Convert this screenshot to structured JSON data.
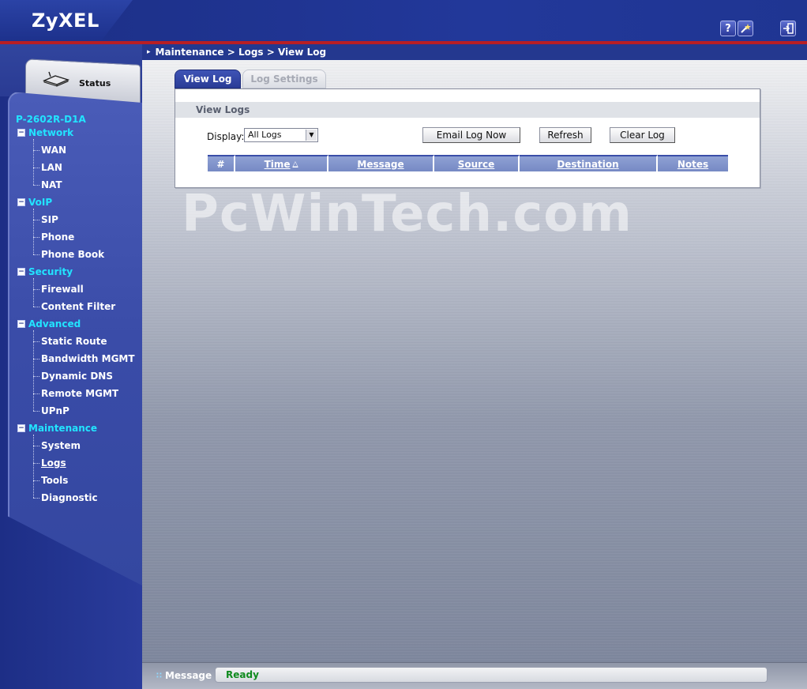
{
  "header": {
    "brand": "ZyXEL",
    "icons": [
      "help-icon",
      "wizard-icon",
      "logout-icon"
    ]
  },
  "sidebar": {
    "status_label": "Status",
    "device": "P-2602R-D1A",
    "sections": [
      {
        "label": "Network",
        "items": [
          "WAN",
          "LAN",
          "NAT"
        ]
      },
      {
        "label": "VoIP",
        "items": [
          "SIP",
          "Phone",
          "Phone Book"
        ]
      },
      {
        "label": "Security",
        "items": [
          "Firewall",
          "Content Filter"
        ]
      },
      {
        "label": "Advanced",
        "items": [
          "Static Route",
          "Bandwidth MGMT",
          "Dynamic DNS",
          "Remote MGMT",
          "UPnP"
        ]
      },
      {
        "label": "Maintenance",
        "items": [
          "System",
          "Logs",
          "Tools",
          "Diagnostic"
        ]
      }
    ],
    "active_item": "Logs"
  },
  "breadcrumb": "Maintenance > Logs > View Log",
  "tabs": [
    {
      "label": "View Log",
      "active": true
    },
    {
      "label": "Log Settings",
      "active": false
    }
  ],
  "panel": {
    "title": "View Logs",
    "display_label": "Display:",
    "display_value": "All Logs",
    "buttons": {
      "email": "Email Log Now",
      "refresh": "Refresh",
      "clear": "Clear Log"
    },
    "columns": [
      "#",
      "Time",
      "Message",
      "Source",
      "Destination",
      "Notes"
    ]
  },
  "watermark": "PcWinTech.com",
  "footer": {
    "message_label": "Message",
    "message_text": "Ready"
  }
}
